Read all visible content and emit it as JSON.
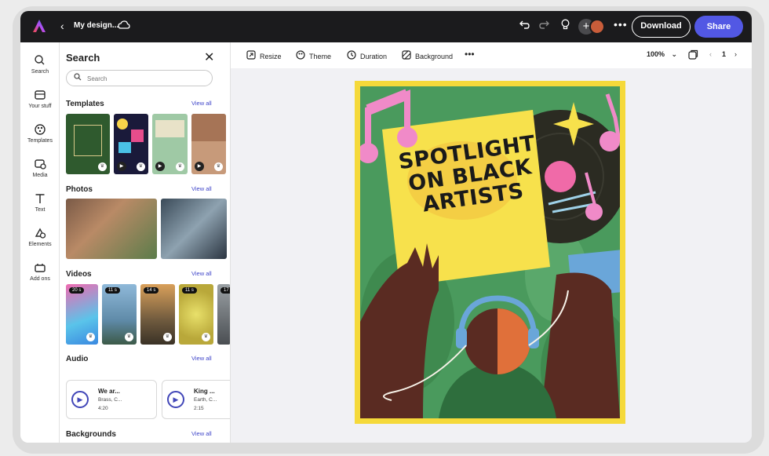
{
  "topbar": {
    "doc_title": "My design...",
    "download_label": "Download",
    "share_label": "Share"
  },
  "rail": {
    "items": [
      {
        "label": "Search",
        "icon": "search-icon"
      },
      {
        "label": "Your stuff",
        "icon": "folder-icon"
      },
      {
        "label": "Templates",
        "icon": "templates-icon"
      },
      {
        "label": "Media",
        "icon": "media-icon"
      },
      {
        "label": "Text",
        "icon": "text-icon"
      },
      {
        "label": "Elements",
        "icon": "elements-icon"
      },
      {
        "label": "Add ons",
        "icon": "add-ons-icon"
      }
    ]
  },
  "panel": {
    "title": "Search",
    "search_placeholder": "Search",
    "view_all": "View all",
    "sections": {
      "templates": "Templates",
      "photos": "Photos",
      "videos": "Videos",
      "audio": "Audio",
      "backgrounds": "Backgrounds"
    },
    "videos": [
      {
        "duration": "20 s"
      },
      {
        "duration": "11 s"
      },
      {
        "duration": "14 s"
      },
      {
        "duration": "11 s"
      },
      {
        "duration": "17"
      }
    ],
    "audio": [
      {
        "name": "We ar...",
        "artist": "Brass, C...",
        "length": "4:20"
      },
      {
        "name": "King ...",
        "artist": "Earth, C...",
        "length": "2:15"
      }
    ]
  },
  "toolbar": {
    "resize": "Resize",
    "theme": "Theme",
    "duration": "Duration",
    "background": "Background",
    "zoom": "100%",
    "page_number": "1"
  },
  "poster": {
    "title_line1": "SPOTLIGHT",
    "title_line2": "ON BLACK",
    "title_line3": "ARTISTS"
  },
  "colors": {
    "accent": "#5258e4",
    "topbar_bg": "#1b1b1d",
    "poster_border": "#f5d93a",
    "poster_bg": "#4a9a5d"
  }
}
